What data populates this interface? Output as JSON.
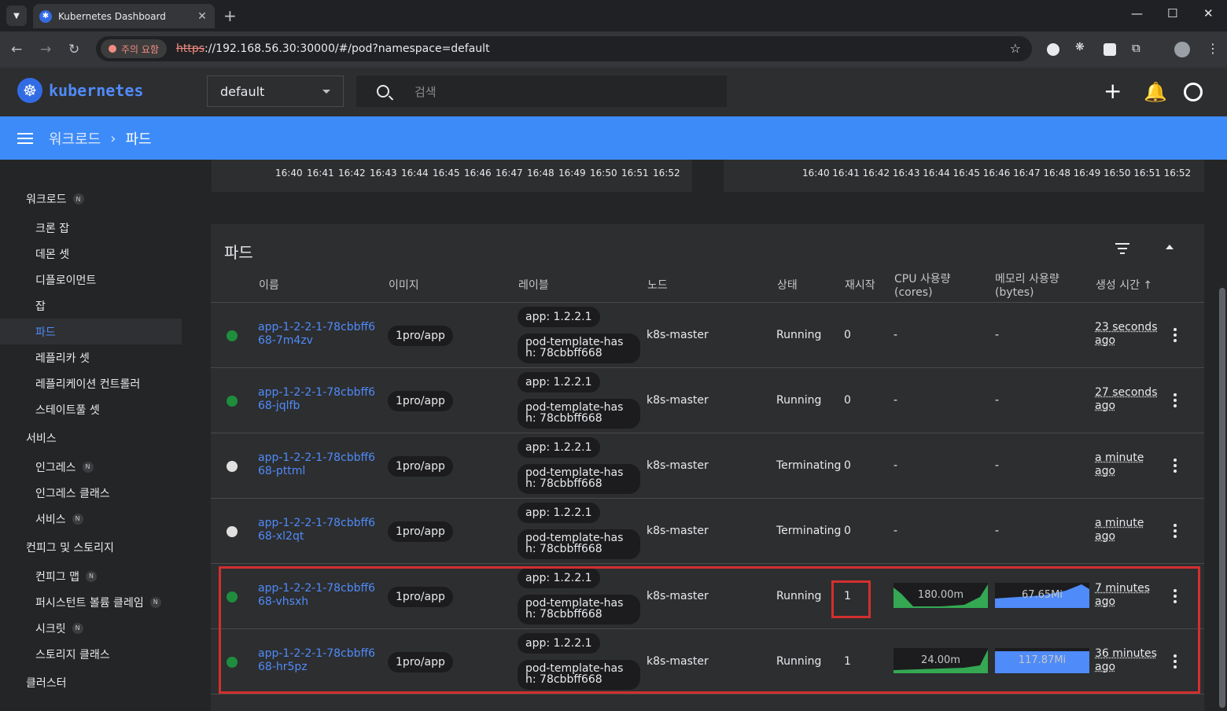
{
  "browser": {
    "tab_title": "Kubernetes Dashboard",
    "security_warning": "주의 요함",
    "url_scheme": "https",
    "url_rest": "://192.168.56.30:30000/#/pod?namespace=default"
  },
  "header": {
    "brand": "kubernetes",
    "namespace": "default",
    "search_placeholder": "검색"
  },
  "breadcrumb": {
    "parent": "워크로드",
    "current": "파드"
  },
  "sidebar": {
    "workloads": "워크로드",
    "workload_items": [
      "크론 잡",
      "데몬 셋",
      "디플로이먼트",
      "잡",
      "파드",
      "레플리카 셋",
      "레플리케이션 컨트롤러",
      "스테이트풀 셋"
    ],
    "services": "서비스",
    "service_items": [
      "인그레스",
      "인그레스 클래스",
      "서비스"
    ],
    "config": "컨피그 및 스토리지",
    "config_items": [
      "컨피그 맵",
      "퍼시스턴트 볼륨 클레임",
      "시크릿",
      "스토리지 클래스"
    ],
    "cluster": "클러스터",
    "badge": "N"
  },
  "charts": {
    "ticks": [
      "16:40",
      "16:41",
      "16:42",
      "16:43",
      "16:44",
      "16:45",
      "16:46",
      "16:47",
      "16:48",
      "16:49",
      "16:50",
      "16:51",
      "16:52"
    ]
  },
  "pods_card": {
    "title": "파드",
    "columns": {
      "name": "이름",
      "image": "이미지",
      "labels": "레이블",
      "node": "노드",
      "status": "상태",
      "restarts": "재시작",
      "cpu": "CPU 사용량 (cores)",
      "memory": "메모리 사용량 (bytes)",
      "created": "생성 시간 ↑"
    },
    "rows": [
      {
        "name": "app-1-2-2-1-78cbbff668-7m4zv",
        "image": "1pro/app",
        "label1": "app: 1.2.2.1",
        "label2": "pod-template-hash: 78cbbff668",
        "node": "k8s-master",
        "status": "Running",
        "restarts": "0",
        "cpu": "-",
        "memory": "-",
        "age": "23 seconds ago",
        "dot": "#1e8e3e"
      },
      {
        "name": "app-1-2-2-1-78cbbff668-jqlfb",
        "image": "1pro/app",
        "label1": "app: 1.2.2.1",
        "label2": "pod-template-hash: 78cbbff668",
        "node": "k8s-master",
        "status": "Running",
        "restarts": "0",
        "cpu": "-",
        "memory": "-",
        "age": "27 seconds ago",
        "dot": "#1e8e3e"
      },
      {
        "name": "app-1-2-2-1-78cbbff668-pttml",
        "image": "1pro/app",
        "label1": "app: 1.2.2.1",
        "label2": "pod-template-hash: 78cbbff668",
        "node": "k8s-master",
        "status": "Terminating",
        "restarts": "0",
        "cpu": "-",
        "memory": "-",
        "age": "a minute ago",
        "dot": "#e0e0e0"
      },
      {
        "name": "app-1-2-2-1-78cbbff668-xl2qt",
        "image": "1pro/app",
        "label1": "app: 1.2.2.1",
        "label2": "pod-template-hash: 78cbbff668",
        "node": "k8s-master",
        "status": "Terminating",
        "restarts": "0",
        "cpu": "-",
        "memory": "-",
        "age": "a minute ago",
        "dot": "#e0e0e0"
      },
      {
        "name": "app-1-2-2-1-78cbbff668-vhsxh",
        "image": "1pro/app",
        "label1": "app: 1.2.2.1",
        "label2": "pod-template-hash: 78cbbff668",
        "node": "k8s-master",
        "status": "Running",
        "restarts": "1",
        "cpu": "180.00m",
        "memory": "67.65Mi",
        "age": "7 minutes ago",
        "dot": "#1e8e3e"
      },
      {
        "name": "app-1-2-2-1-78cbbff668-hr5pz",
        "image": "1pro/app",
        "label1": "app: 1.2.2.1",
        "label2": "pod-template-hash: 78cbbff668",
        "node": "k8s-master",
        "status": "Running",
        "restarts": "1",
        "cpu": "24.00m",
        "memory": "117.87Mi",
        "age": "36 minutes ago",
        "dot": "#1e8e3e"
      }
    ]
  },
  "colors": {
    "accent": "#3d8bf8",
    "link": "#4f8bf9",
    "highlight": "#d32f2f",
    "cpu_spark": "#34a853",
    "mem_spark": "#4f8bf9"
  }
}
